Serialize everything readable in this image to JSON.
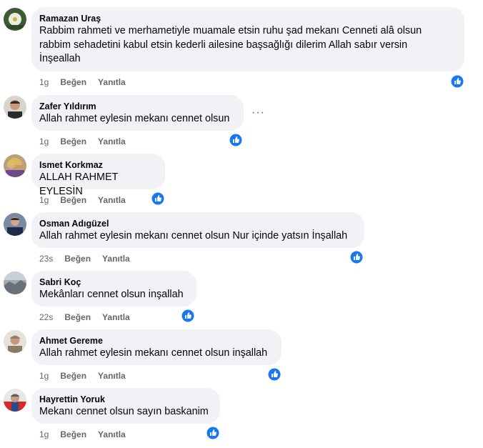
{
  "comments": [
    {
      "author": "Ramazan Uraş",
      "text_lines": [
        "Rabbim rahmeti ve merhametiyle muamale etsin ruhu şad mekanı Cenneti alâ olsun",
        "rabbim sehadetini kabul etsin kederli ailesine başsağlığı dilerim Allah sabır versin",
        "İnşeallah"
      ],
      "time": "1g",
      "like_label": "Beğen",
      "reply_label": "Yanıtla",
      "reaction_icon": "thumbs-up-icon"
    },
    {
      "author": "Zafer Yıldırım",
      "text_lines": [
        "Allah rahmet eylesin mekanı cennet olsun"
      ],
      "time": "1g",
      "like_label": "Beğen",
      "reply_label": "Yanıtla",
      "reaction_icon": "thumbs-up-icon",
      "more_label": "···"
    },
    {
      "author": "Ismet Korkmaz",
      "text_lines": [
        "ALLAH RAHMET EYLESİN"
      ],
      "time": "1g",
      "like_label": "Beğen",
      "reply_label": "Yanıtla",
      "reaction_icon": "thumbs-up-icon"
    },
    {
      "author": "Osman Adıgüzel",
      "text_lines": [
        "Allah rahmet eylesin mekanı cennet olsun Nur içinde yatsın İnşallah"
      ],
      "time": "23s",
      "like_label": "Beğen",
      "reply_label": "Yanıtla",
      "reaction_icon": "thumbs-up-icon"
    },
    {
      "author": "Sabri Koç",
      "text_lines": [
        "Mekânları cennet olsun inşallah"
      ],
      "time": "22s",
      "like_label": "Beğen",
      "reply_label": "Yanıtla",
      "reaction_icon": "thumbs-up-icon"
    },
    {
      "author": "Ahmet Gereme",
      "text_lines": [
        "Allah rahmet eylesin mekanı cennet olsun inşallah"
      ],
      "time": "1g",
      "like_label": "Beğen",
      "reply_label": "Yanıtla",
      "reaction_icon": "thumbs-up-icon"
    },
    {
      "author": "Hayrettin Yoruk",
      "text_lines": [
        "Mekanı cennet olsun sayın baskanim"
      ],
      "time": "1g",
      "like_label": "Beğen",
      "reply_label": "Yanıtla",
      "reaction_icon": "thumbs-up-icon"
    }
  ],
  "colors": {
    "bubble": "#f0f2f5",
    "meta_text": "#65676b",
    "like_blue": "#1877f2"
  }
}
